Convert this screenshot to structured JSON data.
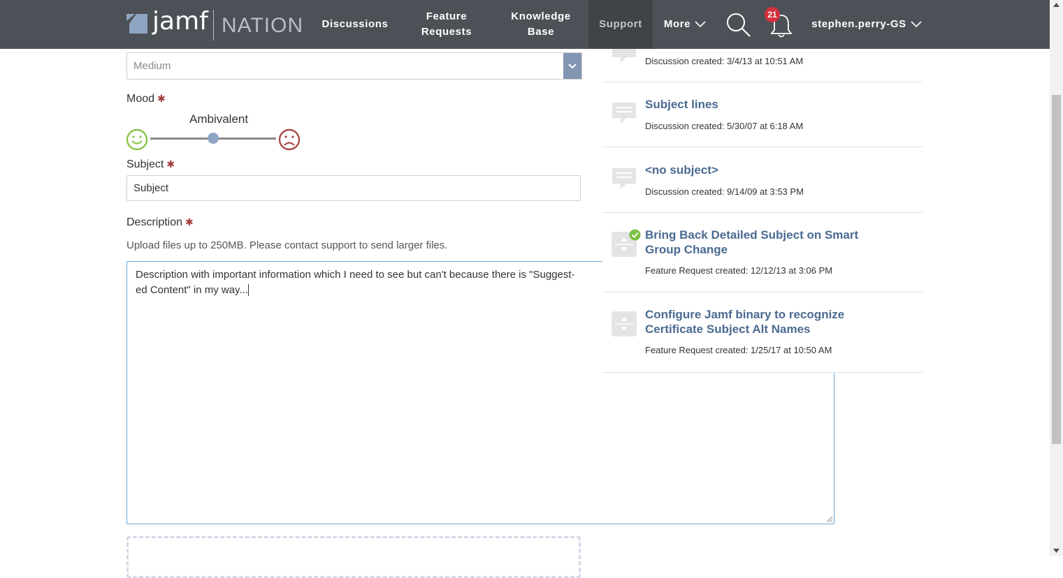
{
  "nav": {
    "logo_text": "jamf",
    "logo_sub": "NATION",
    "items": [
      {
        "label": "Discussions"
      },
      {
        "label": "Feature Requests"
      },
      {
        "label": "Knowledge Base"
      },
      {
        "label": "Support"
      },
      {
        "label": "More"
      }
    ],
    "notification_count": "21",
    "user_name": "stephen.perry-GS",
    "colors": {
      "bar": "#4c5157",
      "badge": "#d6303d"
    }
  },
  "form": {
    "priority_value": "Medium",
    "mood_label": "Mood",
    "mood_value": "Ambivalent",
    "mood_level": 0.5,
    "subject_label": "Subject",
    "subject_value": "Subject",
    "description_label": "Description",
    "upload_note": "Upload files up to 250MB. Please contact support to send larger files.",
    "description_line1": "Description with important information which I need to see but can't because there is \"Suggest-",
    "description_line2": "ed Content\" in my way...",
    "required_mark": "✱"
  },
  "suggested": [
    {
      "title": "",
      "meta": "Discussion created: 3/4/13 at 10:51 AM",
      "icon": "discussion-icon"
    },
    {
      "title": "Subject lines",
      "meta": "Discussion created: 5/30/07 at 6:18 AM",
      "icon": "discussion-icon"
    },
    {
      "title": "<no subject>",
      "meta": "Discussion created: 9/14/09 at 3:53 PM",
      "icon": "discussion-icon"
    },
    {
      "title": "Bring Back Detailed Subject on Smart Group Change",
      "meta": "Feature Request created: 12/12/13 at 3:06 PM",
      "icon": "vote-icon",
      "status": "implemented"
    },
    {
      "title": "Configure Jamf binary to recognize Certificate Subject Alt Names",
      "meta": "Feature Request created: 1/25/17 at 10:50 AM",
      "icon": "vote-icon"
    }
  ]
}
